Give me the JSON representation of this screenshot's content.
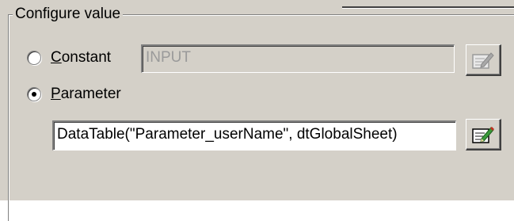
{
  "group": {
    "title": "Configure value"
  },
  "options": {
    "constant": {
      "label_mnemonic": "C",
      "label_rest": "onstant",
      "selected": false,
      "value": "INPUT",
      "enabled": false
    },
    "parameter": {
      "label_mnemonic": "P",
      "label_rest": "arameter",
      "selected": true,
      "value": "DataTable(\"Parameter_userName\", dtGlobalSheet)",
      "enabled": true
    }
  },
  "icons": {
    "constant_edit": "edit-pencil-icon",
    "parameter_edit": "edit-pencil-icon"
  },
  "colors": {
    "face": "#d4d0c8",
    "pencil_green": "#3a9a3a",
    "pencil_red": "#c03020"
  }
}
